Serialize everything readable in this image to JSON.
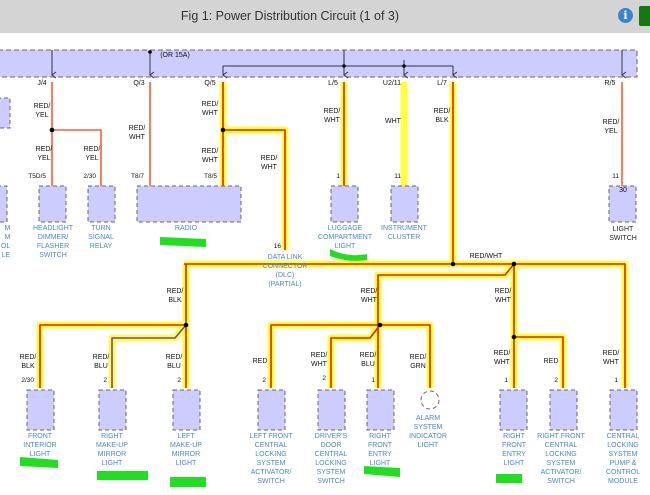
{
  "header": {
    "title": "Fig 1: Power Distribution Circuit (1 of 3)",
    "info_icon": "i"
  },
  "fuse_note": "(OR 15A)",
  "connectors": {
    "j4": "J/4",
    "q3": "Q/3",
    "q5": "Q/5",
    "l5": "L/5",
    "u211": "U2/11",
    "l7": "L/7",
    "r5": "R/5"
  },
  "pins": {
    "t5d5": "T5D/5",
    "p230a": "2/30",
    "t87": "T8/7",
    "t85": "T8/5",
    "p16": "16",
    "p1a": "1",
    "p11a": "11",
    "p11b": "11",
    "p30": "30",
    "p230b": "2/30",
    "p2a": "2",
    "p2b": "2",
    "p2c": "2",
    "p2d": "2",
    "p1b": "1",
    "p1c": "1",
    "p2e": "2",
    "p1d": "1"
  },
  "wires": {
    "w1": "RED/\nYEL",
    "w2": "RED/\nYEL",
    "w3": "RED/\nYEL",
    "w4": "RED/\nWHT",
    "w5": "RED/\nWHT",
    "w6": "RED/\nWHT",
    "w7": "RED/\nWHT",
    "w8": "RED/\nWHT",
    "w9": "WHT",
    "w10": "RED/\nBLK",
    "w11": "RED/\nYEL",
    "bus": "RED/WHT",
    "w12": "RED/\nBLK",
    "w13": "RED/\nWHT",
    "w14": "RED/\nWHT",
    "w15": "RED/\nBLK",
    "w16": "RED/\nBLU",
    "w17": "RED/\nBLU",
    "w18": "RED",
    "w19": "RED/\nWHT",
    "w20": "RED/\nBLU",
    "w21": "RED/\nGRN",
    "w22": "RED/\nWHT",
    "w23": "RED",
    "w24": "RED/\nWHT"
  },
  "components": {
    "left_partial": "M\nM\nOL\nLE",
    "headlight": "HEADLIGHT\nDIMMER/\nFLASHER\nSWITCH",
    "turn": "TURN\nSIGNAL\nRELAY",
    "radio": "RADIO",
    "dlc": "DATA LINK\nCONNECTOR\n(DLC)\n(PARTIAL)",
    "luggage": "LUGGAGE\nCOMPARTMENT\nLIGHT",
    "cluster": "INSTRUMENT\nCLUSTER",
    "light_switch": "LIGHT\nSWITCH",
    "front_interior": "FRONT\nINTERIOR\nLIGHT",
    "right_mirror": "RIGHT\nMAKE-UP\nMIRROR\nLIGHT",
    "left_mirror": "LEFT\nMAKE-UP\nMIRROR\nLIGHT",
    "lf_locking": "LEFT FRONT\nCENTRAL\nLOCKING\nSYSTEM\nACTIVATOR/\nSWITCH",
    "driver_door": "DRIVER'S\nDOOR\nCENTRAL\nLOCKING\nSYSTEM\nSWITCH",
    "rf_entry_a": "RIGHT\nFRONT\nENTRY\nLIGHT",
    "alarm": "ALARM\nSYSTEM\nINDICATOR\nLIGHT",
    "rf_entry_b": "RIGHT\nFRONT\nENTRY\nLIGHT",
    "rf_locking": "RIGHT FRONT\nCENTRAL\nLOCKING\nSYSTEM\nACTIVATOR/\nSWITCH",
    "pump": "CENTRAL\nLOCKING\nSYSTEM\nPUMP &\nCONTROL\nMODULE"
  },
  "colors": {
    "wire": "#ff5a30",
    "highlight": "#ffff40",
    "box": "#ccccff",
    "mark": "#22dd22",
    "label": "#4b86c8"
  }
}
